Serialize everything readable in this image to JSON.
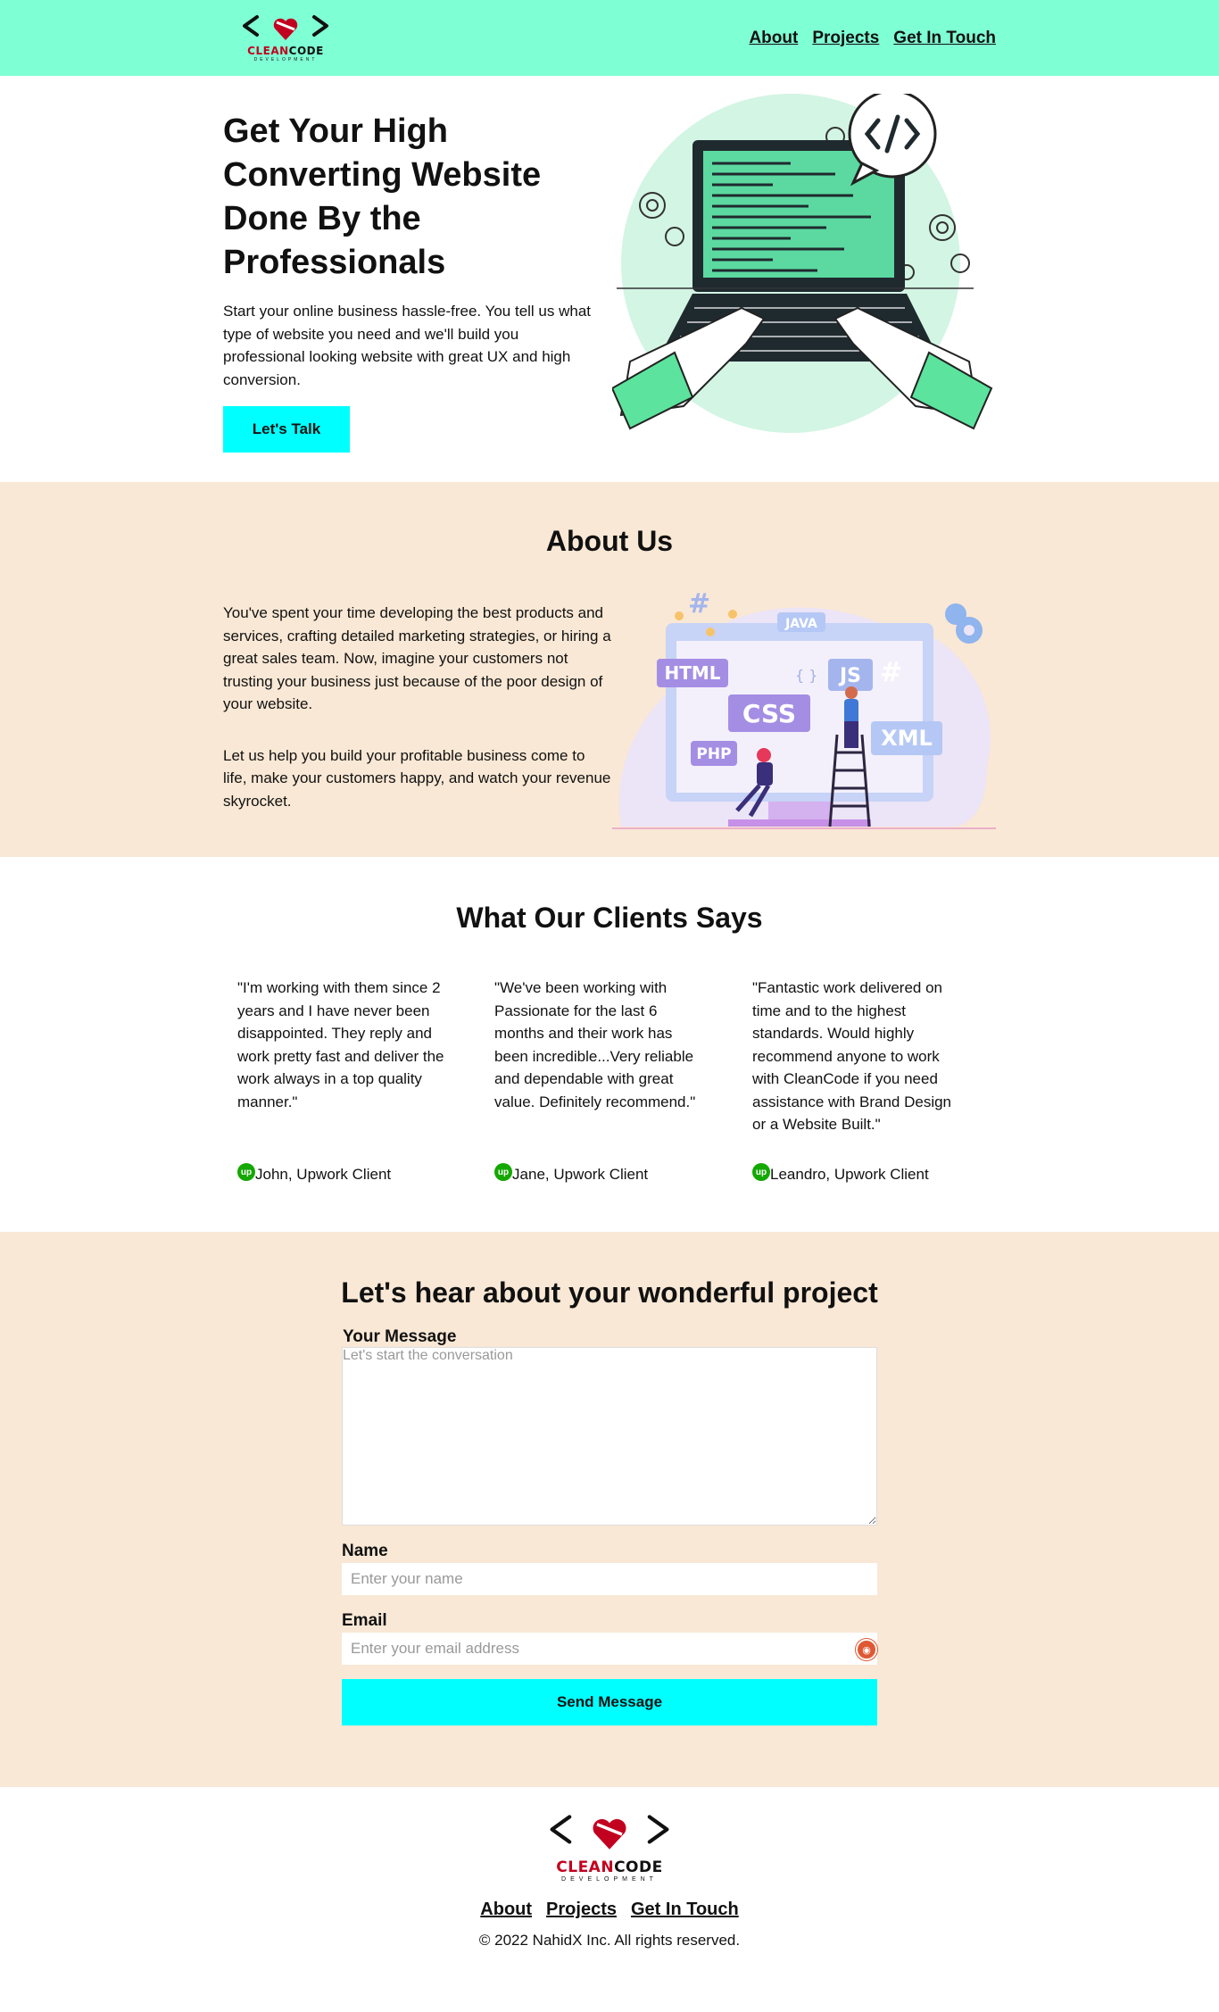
{
  "header": {
    "logo_word_red": "CLEAN",
    "logo_word_dark": "CODE",
    "logo_sub": "DEVELOPMENT",
    "nav": [
      "About",
      "Projects",
      "Get In Touch"
    ]
  },
  "hero": {
    "title": "Get Your High Converting Website Done By the Professionals",
    "description": "Start your online business hassle-free. You tell us what type of website you need and we'll build you professional looking website with great UX and high conversion.",
    "cta": "Let's Talk"
  },
  "about": {
    "title": "About Us",
    "p1": "You've spent your time developing the best products and services, crafting detailed marketing strategies, or hiring a great sales team. Now, imagine your customers not trusting your business just because of the poor design of your website.",
    "p2": "Let us help you build your profitable business come to life, make your customers happy, and watch your revenue skyrocket.",
    "art_labels": [
      "HTML",
      "CSS",
      "JS",
      "PHP",
      "XML",
      "JAVA",
      "#",
      "{ }"
    ]
  },
  "clients": {
    "title": "What Our Clients Says",
    "testimonials": [
      {
        "quote": "\"I'm working with them since 2 years and I have never been disappointed. They reply and work pretty fast and deliver the work always in a top quality manner.\"",
        "author": "John, Upwork Client"
      },
      {
        "quote": "\"We've been working with Passionate for the last 6 months and their work has been incredible...Very reliable and dependable with great value. Definitely recommend.\"",
        "author": "Jane, Upwork Client"
      },
      {
        "quote": "\"Fantastic work delivered on time and to the highest standards. Would highly recommend anyone to work with CleanCode if you need assistance with Brand Design or a Website Built.\"",
        "author": "Leandro, Upwork Client"
      }
    ],
    "icon_text": "up"
  },
  "contact": {
    "title": "Let's hear about your wonderful project",
    "message_label": "Your Message",
    "message_placeholder": "Let's start the conversation",
    "name_label": "Name",
    "name_placeholder": "Enter your name",
    "email_label": "Email",
    "email_placeholder": "Enter your email address",
    "submit": "Send Message"
  },
  "footer": {
    "nav": [
      "About",
      "Projects",
      "Get In Touch"
    ],
    "copyright": "© 2022 NahidX Inc. All rights reserved."
  },
  "colors": {
    "header_bg": "#7fffd4",
    "section_alt_bg": "#f9e8d5",
    "button_bg": "#00ffff",
    "upwork_green": "#14a800",
    "logo_red": "#c2001f"
  }
}
